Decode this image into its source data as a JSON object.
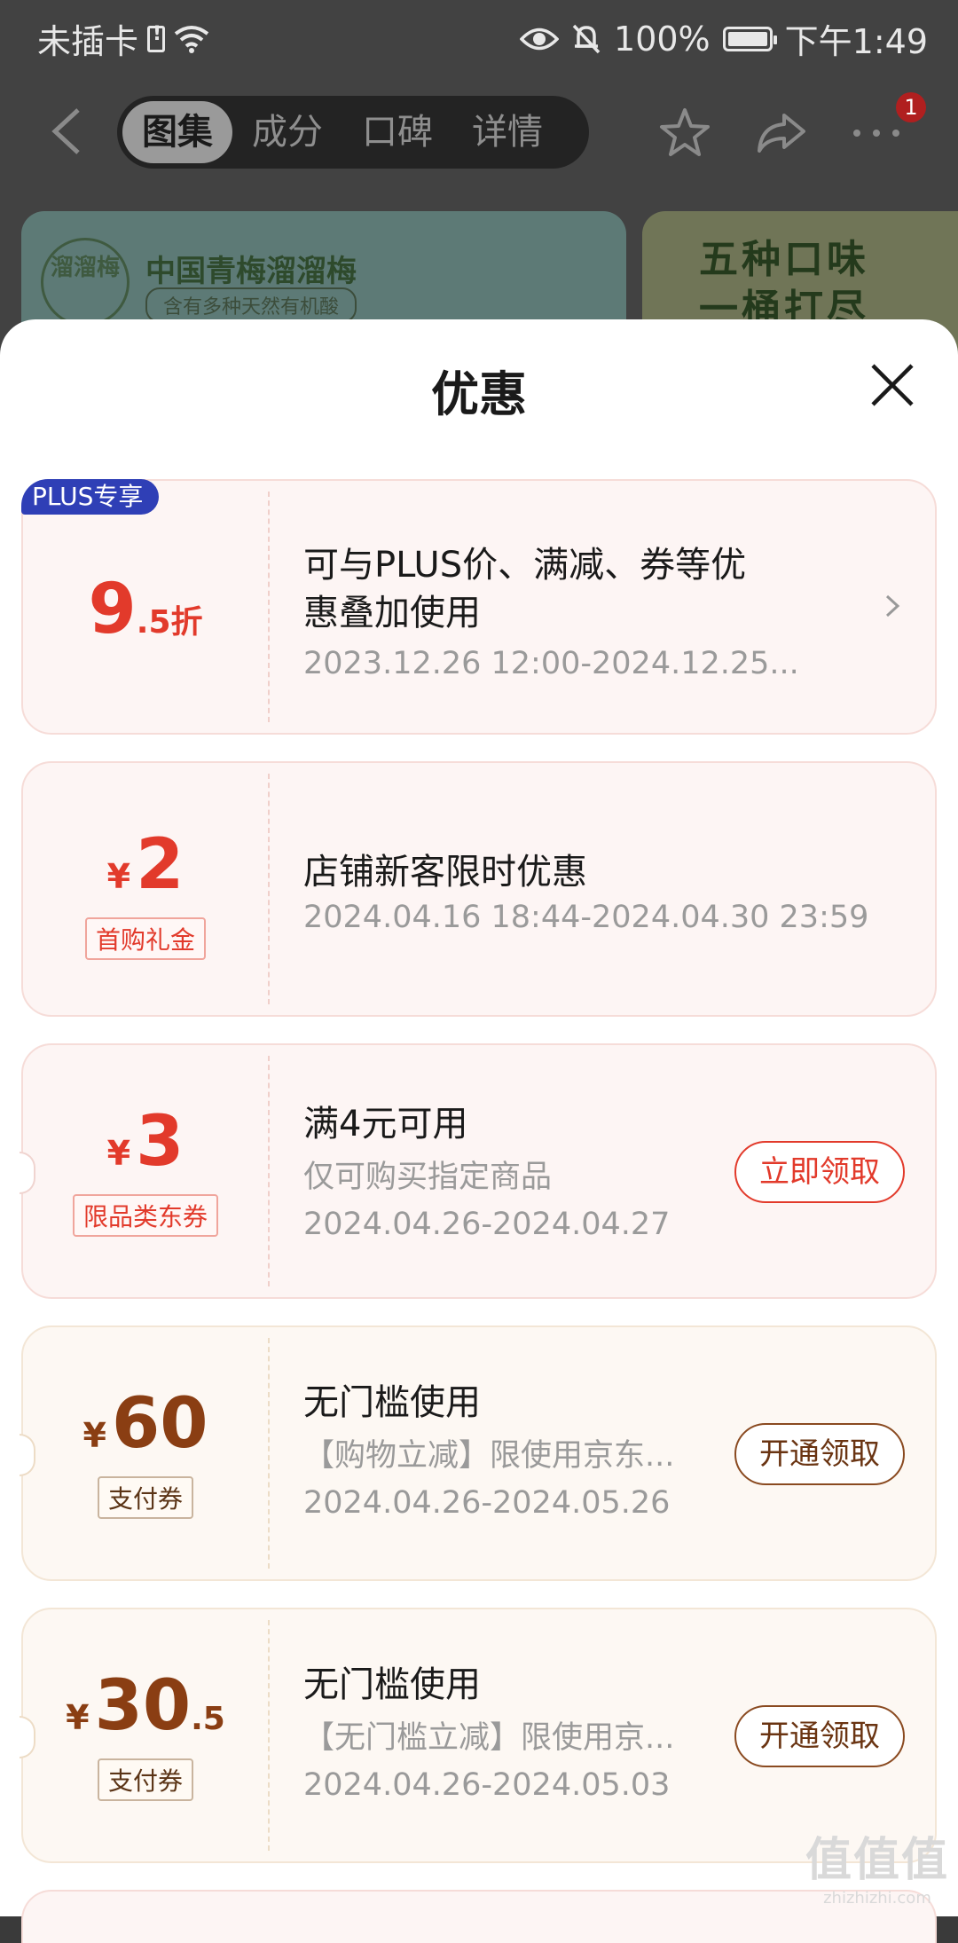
{
  "status_bar": {
    "carrier": "未插卡",
    "battery": "100%",
    "time": "下午1:49"
  },
  "nav": {
    "tabs": [
      "图集",
      "成分",
      "口碑",
      "详情"
    ],
    "badge_count": "1"
  },
  "banners": {
    "banner1_logo": "溜溜梅",
    "banner1_title": "中国青梅溜溜梅",
    "banner1_sub": "含有多种天然有机酸",
    "banner2_line1": "五种口味",
    "banner2_line2": "一桶打尽"
  },
  "sheet": {
    "title": "优惠"
  },
  "coupons": [
    {
      "tag": "PLUS专享",
      "amount_big": "9",
      "amount_small": ".5折",
      "title": "可与PLUS价、满减、券等优",
      "title2": "惠叠加使用",
      "date": "2023.12.26 12:00-2024.12.25..."
    },
    {
      "yen": "¥",
      "amount_big": "2",
      "label": "首购礼金",
      "title": "店铺新客限时优惠",
      "date": "2024.04.16 18:44-2024.04.30 23:59"
    },
    {
      "yen": "¥",
      "amount_big": "3",
      "label": "限品类东券",
      "title": "满4元可用",
      "desc": "仅可购买指定商品",
      "date": "2024.04.26-2024.04.27",
      "action": "立即领取"
    },
    {
      "yen": "¥",
      "amount_big": "60",
      "label": "支付券",
      "title": "无门槛使用",
      "desc": "【购物立减】限使用京东...",
      "date": "2024.04.26-2024.05.26",
      "action": "开通领取"
    },
    {
      "yen": "¥",
      "amount_big": "30",
      "amount_small": ".5",
      "label": "支付券",
      "title": "无门槛使用",
      "desc": "【无门槛立减】限使用京...",
      "date": "2024.04.26-2024.05.03",
      "action": "开通领取"
    }
  ],
  "watermark": {
    "big": "值值值",
    "small": "zhizhizhi.com"
  },
  "colors": {
    "accent_red": "#e23a2b",
    "gold_text": "#8a3e13",
    "plus_blue": "#2f3fb6"
  }
}
